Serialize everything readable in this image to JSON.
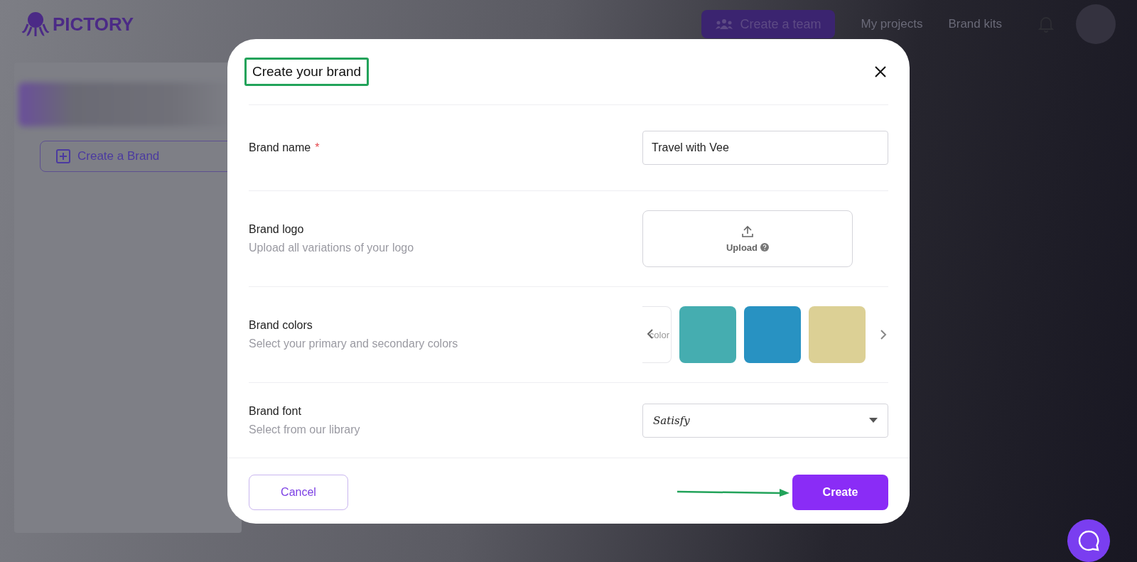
{
  "header": {
    "logo_text": "PICTORY",
    "team_button": "Create a team",
    "nav": [
      "My projects",
      "Brand kits"
    ]
  },
  "sidebar": {
    "create_button": "Create a Brand"
  },
  "modal": {
    "title": "Create your brand",
    "title_highlighted": true,
    "fields": [
      {
        "kind": "text",
        "label": "Brand name",
        "required": true,
        "required_mark": "*",
        "value": "Travel with Vee"
      },
      {
        "kind": "upload",
        "label": "Brand logo",
        "hint": "Upload all variations of your logo",
        "button": "Upload"
      },
      {
        "kind": "colors",
        "label": "Brand colors",
        "hint": "Select your primary and secondary colors",
        "add_tile": "color",
        "swatches": [
          {
            "color": "#45adb0"
          },
          {
            "color": "#2892c2"
          },
          {
            "color": "#dcd095"
          }
        ]
      },
      {
        "kind": "font",
        "label": "Brand font",
        "hint": "Select from our library",
        "value": "Satisfy"
      }
    ],
    "cancel": "Cancel",
    "create": "Create",
    "arrow_to_create": true
  }
}
